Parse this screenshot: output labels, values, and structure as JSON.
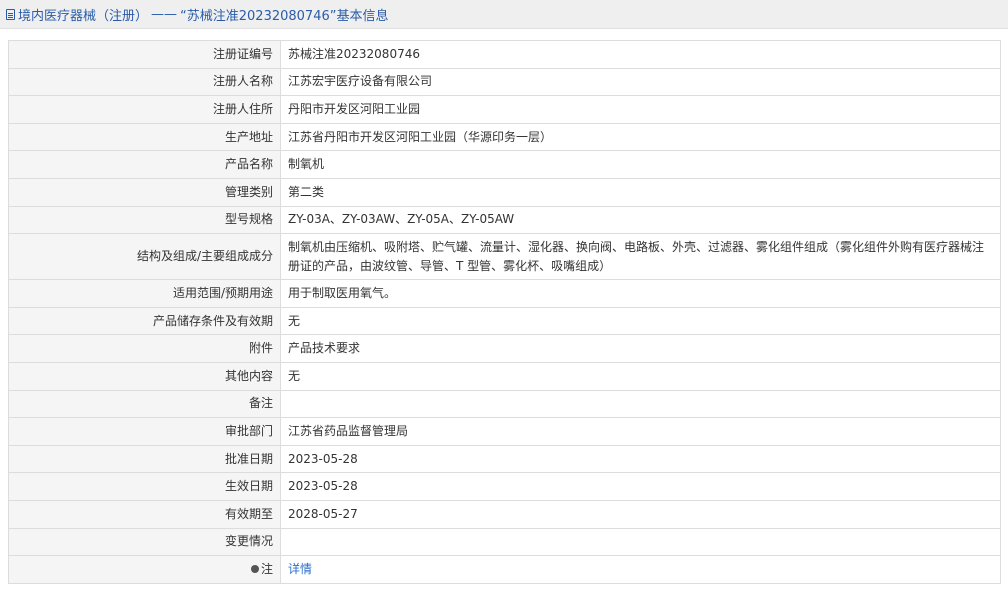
{
  "header": {
    "icon": "document-icon",
    "title_prefix": "境内医疗器械（注册）",
    "separator": "——",
    "title_main": "“苏械注准20232080746”基本信息",
    "color": "#2a5caa"
  },
  "rows": [
    {
      "label": "注册证编号",
      "value": "苏械注准20232080746"
    },
    {
      "label": "注册人名称",
      "value": "江苏宏宇医疗设备有限公司"
    },
    {
      "label": "注册人住所",
      "value": "丹阳市开发区河阳工业园"
    },
    {
      "label": "生产地址",
      "value": "江苏省丹阳市开发区河阳工业园（华源印务一层）"
    },
    {
      "label": "产品名称",
      "value": "制氧机"
    },
    {
      "label": "管理类别",
      "value": "第二类"
    },
    {
      "label": "型号规格",
      "value": "ZY-03A、ZY-03AW、ZY-05A、ZY-05AW"
    },
    {
      "label": "结构及组成/主要组成成分",
      "value": "制氧机由压缩机、吸附塔、贮气罐、流量计、湿化器、换向阀、电路板、外壳、过滤器、雾化组件组成（雾化组件外购有医疗器械注册证的产品，由波纹管、导管、T 型管、雾化杯、吸嘴组成）"
    },
    {
      "label": "适用范围/预期用途",
      "value": "用于制取医用氧气。"
    },
    {
      "label": "产品储存条件及有效期",
      "value": "无"
    },
    {
      "label": "附件",
      "value": "产品技术要求"
    },
    {
      "label": "其他内容",
      "value": "无"
    },
    {
      "label": "备注",
      "value": ""
    },
    {
      "label": "审批部门",
      "value": "江苏省药品监督管理局"
    },
    {
      "label": "批准日期",
      "value": "2023-05-28"
    },
    {
      "label": "生效日期",
      "value": "2023-05-28"
    },
    {
      "label": "有效期至",
      "value": "2028-05-27"
    },
    {
      "label": "变更情况",
      "value": ""
    }
  ],
  "note_row": {
    "icon": "lightbulb-icon",
    "label": "注",
    "link_text": "详情",
    "link_color": "#2a6fc9"
  }
}
